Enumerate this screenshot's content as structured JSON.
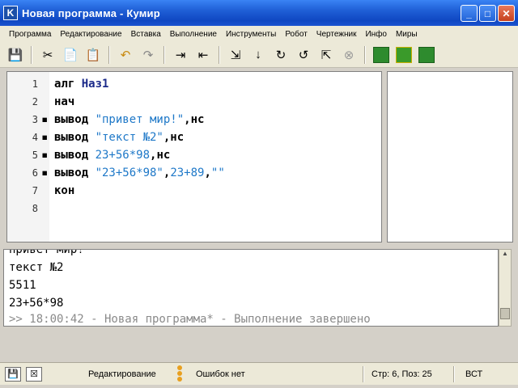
{
  "window": {
    "app_icon": "K",
    "title": "Новая программа - Кумир",
    "buttons": {
      "minimize": "_",
      "maximize": "□",
      "close": "✕"
    }
  },
  "menu": [
    "Программа",
    "Редактирование",
    "Вставка",
    "Выполнение",
    "Инструменты",
    "Робот",
    "Чертежник",
    "Инфо",
    "Миры"
  ],
  "toolbar": {
    "icons": [
      "save-icon",
      "cut-icon",
      "copy-icon",
      "paste-icon",
      "undo-icon",
      "redo-icon",
      "indent-icon",
      "unindent-icon",
      "run-icon",
      "step-icon",
      "step-into-icon",
      "step-out-icon",
      "step-back-icon",
      "stop-icon",
      "robot-world-icon",
      "robot-icon",
      "drawer-icon"
    ]
  },
  "editor": {
    "lines": [
      {
        "n": "1",
        "marker": "",
        "parts": [
          [
            "kw",
            "алг "
          ],
          [
            "name",
            "Наз1"
          ]
        ]
      },
      {
        "n": "2",
        "marker": "",
        "parts": [
          [
            "kw",
            "нач"
          ]
        ]
      },
      {
        "n": "3",
        "marker": "▪",
        "parts": [
          [
            "kw",
            "вывод "
          ],
          [
            "str",
            "\"привет мир!\""
          ],
          [
            "kw",
            ",нс"
          ]
        ]
      },
      {
        "n": "4",
        "marker": "▪",
        "parts": [
          [
            "kw",
            "вывод "
          ],
          [
            "str",
            "\"текст №2\""
          ],
          [
            "kw",
            ",нс"
          ]
        ]
      },
      {
        "n": "5",
        "marker": "▪",
        "parts": [
          [
            "kw",
            "вывод "
          ],
          [
            "num",
            "23+56*98"
          ],
          [
            "kw",
            ",нс"
          ]
        ]
      },
      {
        "n": "6",
        "marker": "▪",
        "parts": [
          [
            "kw",
            "вывод "
          ],
          [
            "str",
            "\"23+56*98\""
          ],
          [
            "kw",
            ","
          ],
          [
            "num",
            "23+89"
          ],
          [
            "kw",
            ","
          ],
          [
            "str",
            "\"\""
          ]
        ]
      },
      {
        "n": "7",
        "marker": "",
        "parts": [
          [
            "kw",
            "кон"
          ]
        ]
      },
      {
        "n": "8",
        "marker": "",
        "parts": []
      }
    ]
  },
  "output": {
    "lines": [
      "привет мир!",
      "текст №2",
      "5511",
      "23+56*98"
    ],
    "status": ">> 18:00:42 - Новая программа* - Выполнение завершено"
  },
  "statusbar": {
    "mode": "Редактирование",
    "errors": "Ошибок нет",
    "position": "Стр: 6, Поз: 25",
    "insert_mode": "ВСТ"
  },
  "colors": {
    "titlebar": "#1f5fd6",
    "string": "#1e78c8",
    "panel": "#ece9d8"
  }
}
